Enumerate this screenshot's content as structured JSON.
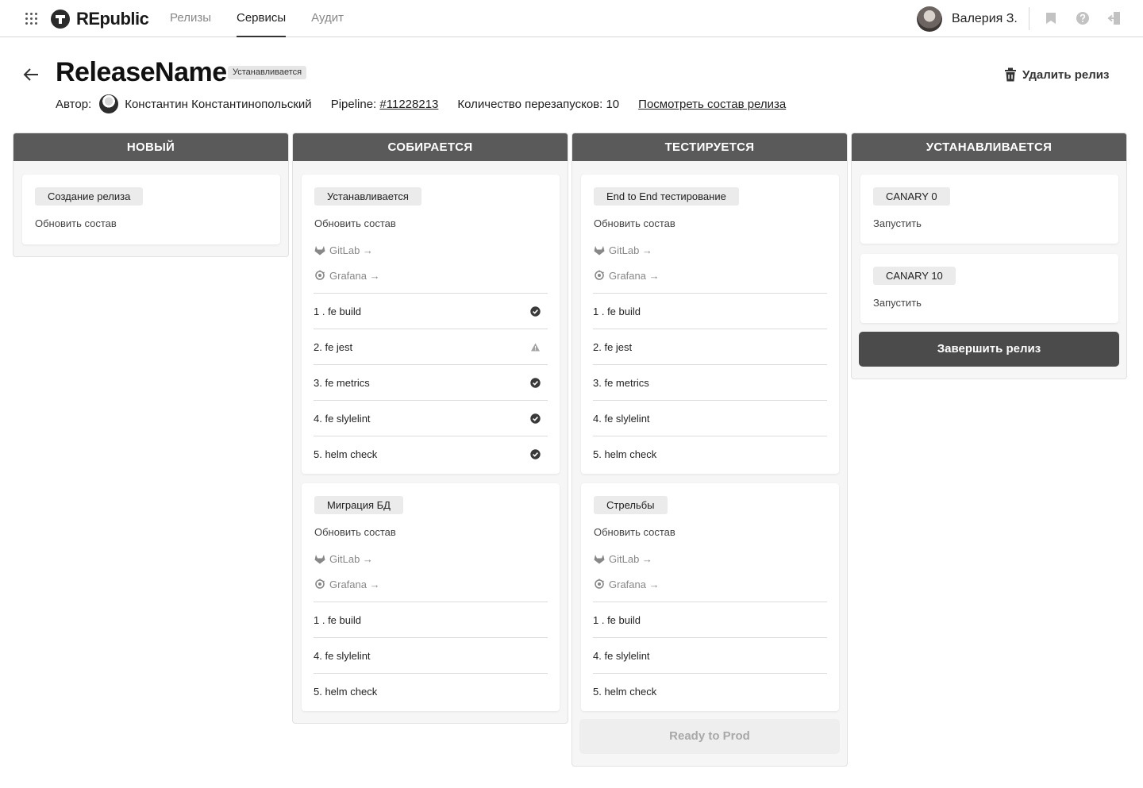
{
  "header": {
    "logo": "REpublic",
    "nav": [
      "Релизы",
      "Сервисы",
      "Аудит"
    ],
    "user_name": "Валерия З."
  },
  "page": {
    "title": "ReleaseName",
    "status_badge": "Устанавливается",
    "delete_label": "Удалить релиз",
    "author_label": "Автор:",
    "author_name": "Константин Константинопольский",
    "pipeline_label": "Pipeline:",
    "pipeline_link": "#11228213",
    "restarts": "Количество перезапусков: 10",
    "view_link": "Посмотреть состав релиза"
  },
  "columns": [
    {
      "title": "НОВЫЙ",
      "cards": [
        {
          "chip": "Создание релиза",
          "link": "Обновить состав"
        }
      ]
    },
    {
      "title": "СОБИРАЕТСЯ",
      "cards": [
        {
          "chip": "Устанавливается",
          "link": "Обновить состав",
          "gitlab": "GitLab →",
          "grafana": "Grafana →",
          "steps": [
            {
              "label": "1 . fe build",
              "status": "check-icon"
            },
            {
              "label": "2. fe jest",
              "status": "warning-icon"
            },
            {
              "label": "3. fe metrics",
              "status": "check-icon"
            },
            {
              "label": "4. fe slylelint",
              "status": "check-icon"
            },
            {
              "label": "5. helm check",
              "status": "check-icon"
            }
          ]
        },
        {
          "chip": "Миграция БД",
          "link": "Обновить состав",
          "gitlab": "GitLab →",
          "grafana": "Grafana →",
          "steps": [
            {
              "label": "1 . fe build"
            },
            {
              "label": "4. fe slylelint"
            },
            {
              "label": "5. helm check"
            }
          ]
        }
      ]
    },
    {
      "title": "ТЕСТИРУЕТСЯ",
      "cards": [
        {
          "chip": "End to End тестирование",
          "link": "Обновить состав",
          "gitlab": "GitLab →",
          "grafana": "Grafana →",
          "steps": [
            {
              "label": "1 . fe build"
            },
            {
              "label": "2. fe jest"
            },
            {
              "label": "3. fe metrics"
            },
            {
              "label": "4. fe slylelint"
            },
            {
              "label": "5. helm check"
            }
          ]
        },
        {
          "chip": "Стрельбы",
          "link": "Обновить состав",
          "gitlab": "GitLab →",
          "grafana": "Grafana →",
          "steps": [
            {
              "label": "1 . fe build"
            },
            {
              "label": "4. fe slylelint"
            },
            {
              "label": "5. helm check"
            }
          ]
        }
      ],
      "button": "Ready to Prod"
    },
    {
      "title": "УСТАНАВЛИВАЕТСЯ",
      "cards": [
        {
          "chip": "CANARY 0",
          "link": "Запустить"
        },
        {
          "chip": "CANARY 10",
          "link": "Запустить"
        }
      ],
      "button": "Завершить релиз"
    }
  ]
}
